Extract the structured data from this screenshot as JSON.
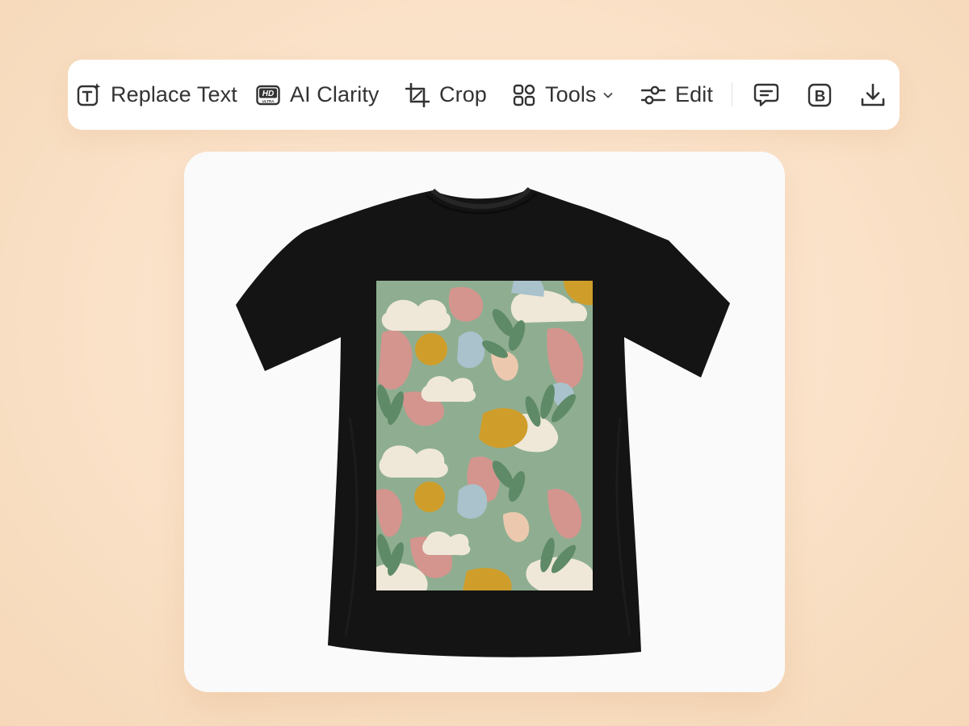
{
  "toolbar": {
    "items": [
      {
        "label": "Replace Text",
        "icon": "replace-text-icon"
      },
      {
        "label": "AI Clarity",
        "icon": "hd-ultra-icon",
        "icon_text_top": "HD",
        "icon_text_bottom": "ULTRA"
      },
      {
        "label": "Crop",
        "icon": "crop-icon"
      },
      {
        "label": "Tools",
        "icon": "grid-tools-icon",
        "dropdown_icon": "chevron-down-icon"
      },
      {
        "label": "Edit",
        "icon": "sliders-icon"
      }
    ],
    "icon_actions": [
      {
        "icon": "comment-icon"
      },
      {
        "icon": "bold-b-icon",
        "glyph": "B"
      },
      {
        "icon": "download-icon"
      }
    ]
  },
  "preview": {
    "subject": "black t-shirt with pastel abstract camouflage print",
    "colors": {
      "shirt": "#141414",
      "print_green": "#8fae91",
      "print_pink": "#d3958e",
      "print_cream": "#efe8d8",
      "print_mustard": "#cf9d2a",
      "print_blue": "#a9c2cc",
      "print_leaf": "#5f8a68",
      "print_peach": "#ecc9ae"
    }
  }
}
